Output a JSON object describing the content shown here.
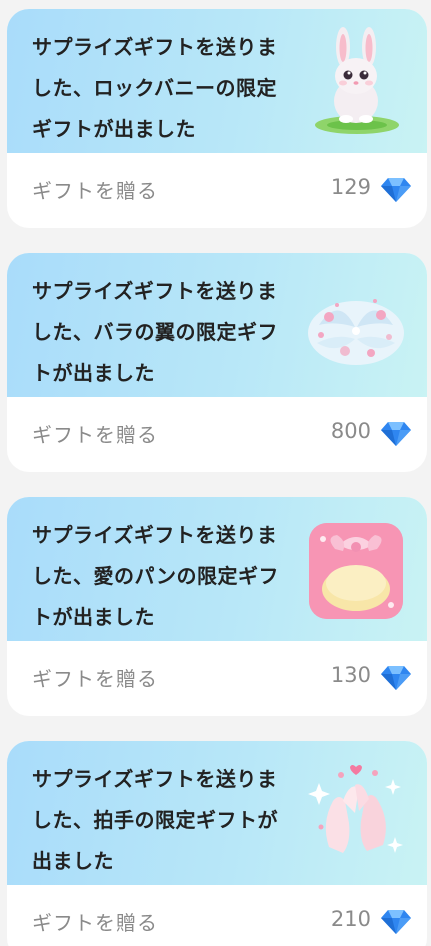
{
  "gifts": [
    {
      "message": "サプライズギフトを送りました、ロックバニーの限定ギフトが出ました",
      "send_label": "ギフトを贈る",
      "price": "129",
      "icon": "bunny-gift-icon"
    },
    {
      "message": "サプライズギフトを送りました、バラの翼の限定ギフトが出ました",
      "send_label": "ギフトを贈る",
      "price": "800",
      "icon": "rose-wings-gift-icon"
    },
    {
      "message": "サプライズギフトを送りました、愛のパンの限定ギフトが出ました",
      "send_label": "ギフトを贈る",
      "price": "130",
      "icon": "love-bread-gift-icon"
    },
    {
      "message": "サプライズギフトを送りました、拍手の限定ギフトが出ました",
      "send_label": "ギフトを贈る",
      "price": "210",
      "icon": "applause-gift-icon"
    }
  ],
  "currency_icon": "diamond-icon",
  "colors": {
    "card_header_gradient_start": "#a9dcfa",
    "card_header_gradient_end": "#c9f3f4",
    "diamond": "#2f86f0",
    "muted_text": "#8a8a8a"
  }
}
